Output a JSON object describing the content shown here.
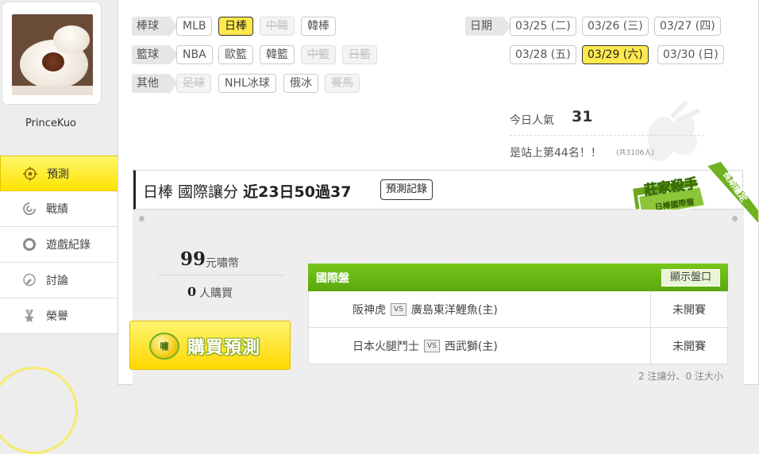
{
  "user": {
    "username": "PrinceKuo",
    "avatar": "steamed-bun-photo"
  },
  "side_menu": [
    {
      "label": "預測",
      "icon": "target-icon",
      "active": true
    },
    {
      "label": "戰績",
      "icon": "swirl-icon",
      "active": false
    },
    {
      "label": "遊戲紀錄",
      "icon": "ring-icon",
      "active": false
    },
    {
      "label": "討論",
      "icon": "chat-icon",
      "active": false
    },
    {
      "label": "榮譽",
      "icon": "medal-icon",
      "active": false
    }
  ],
  "filters": {
    "baseball": {
      "label": "棒球",
      "items": [
        "MLB",
        "日棒",
        "中職",
        "韓棒"
      ]
    },
    "basketball": {
      "label": "籃球",
      "items": [
        "NBA",
        "歐籃",
        "韓籃",
        "中籃",
        "日籃"
      ]
    },
    "other": {
      "label": "其他",
      "items": [
        "足球",
        "NHL冰球",
        "俄冰",
        "賽馬"
      ]
    }
  },
  "dates": {
    "label": "日期",
    "items": [
      "03/25 (二)",
      "03/26 (三)",
      "03/27 (四)",
      "03/28 (五)",
      "03/29 (六)",
      "03/30 (日)"
    ],
    "selected": "03/29 (六)"
  },
  "popularity": {
    "label": "今日人氣",
    "value": "31",
    "rank_text": "是站上第44名！！",
    "rank_total": "(共3106人)"
  },
  "prediction": {
    "category": "日棒 國際讓分",
    "record": "近23日50過37",
    "record_button": "預測記錄",
    "badge": {
      "title": "莊家殺手",
      "subtitle": "日棒國際盤",
      "ribbon": "長期穩定"
    }
  },
  "price": {
    "value": "99",
    "unit": "元嘯幣"
  },
  "buyers": {
    "value": "0",
    "unit": "人購買"
  },
  "buy_button": {
    "label": "購買預測",
    "coin": "嘯"
  },
  "market": {
    "title": "國際盤",
    "show_odds_label": "顯示盤口",
    "games": [
      {
        "away": "阪神虎",
        "home": "廣島東洋鯉魚(主)",
        "vs": "VS",
        "status": "未開賽"
      },
      {
        "away": "日本火腿鬥士",
        "home": "西武獅(主)",
        "vs": "VS",
        "status": "未開賽"
      }
    ],
    "summary": "2 注讓分、0 注大小"
  },
  "colors": {
    "accent_yellow": "#ffe94d",
    "market_green": "#6bb817",
    "badge_green": "#7bbf1e"
  }
}
